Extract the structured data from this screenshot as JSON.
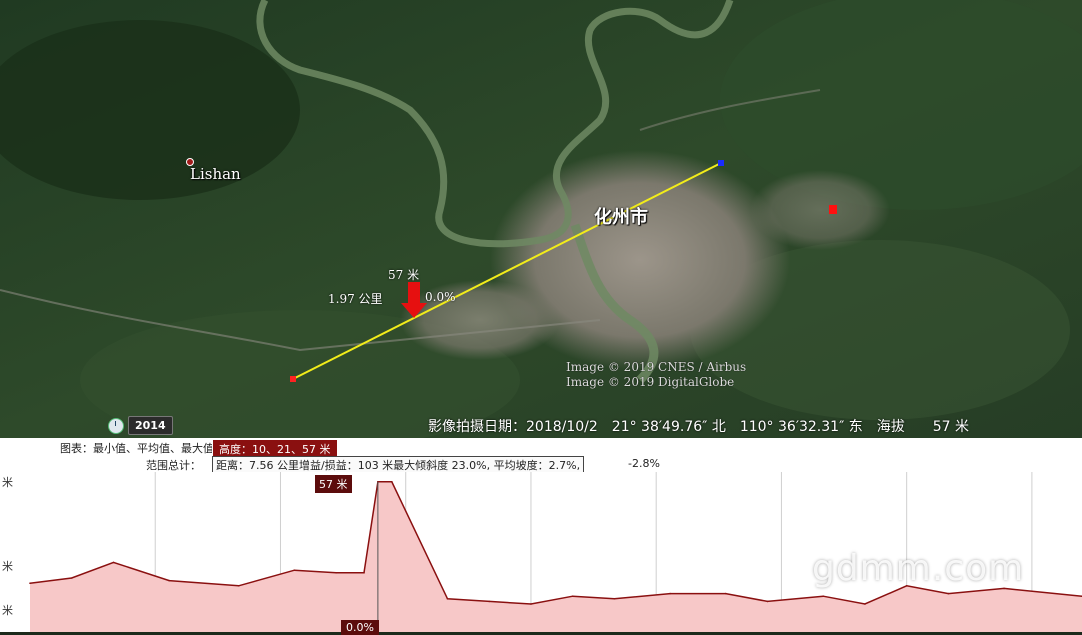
{
  "map": {
    "places": {
      "lishan": "Lishan",
      "city": "化州市"
    },
    "measure": {
      "height": "57 米",
      "distance": "1.97 公里",
      "grade": "0.0%"
    },
    "credits": [
      "Image © 2019 CNES / Airbus",
      "Image © 2019 DigitalGlobe"
    ],
    "status": {
      "imagery_date": "影像拍摄日期：2018/10/2",
      "latitude": "21° 38′49.76″ 北",
      "longitude": "110° 36′32.31″ 东",
      "elevation_label": "海拔",
      "elevation_value": "57 米"
    },
    "historical_year": "2014",
    "colors": {
      "path": "#f2ec1a",
      "start_marker": "#ff2222",
      "end_marker": "#1a2cff",
      "arrow": "#e61010"
    }
  },
  "profile": {
    "legend_label": "图表：最小值、平均值、最大值",
    "legend_value": "高度：10、21、57 米",
    "summary_label": "范围总计：",
    "summary_value": "距离：7.56 公里增益/损益：103 米最大倾斜度 23.0%, 平均坡度：2.7%,",
    "summary_extra": "-2.8%",
    "axis_unit": "米",
    "peak_label": "57 米",
    "cursor_label": "0.0%",
    "watermark": "gdmm.com",
    "colors": {
      "line": "#8a1010",
      "fill": "#f7c8c8"
    }
  },
  "chart_data": {
    "type": "area",
    "x": [
      0,
      0.3,
      0.6,
      1.0,
      1.5,
      1.9,
      2.2,
      2.4,
      2.5,
      2.6,
      3.0,
      3.3,
      3.6,
      3.9,
      4.2,
      4.6,
      5.0,
      5.3,
      5.7,
      6.0,
      6.3,
      6.6,
      7.0,
      7.56
    ],
    "values": [
      18,
      20,
      26,
      19,
      17,
      23,
      22,
      22,
      57,
      57,
      12,
      11,
      10,
      13,
      12,
      14,
      14,
      11,
      13,
      10,
      17,
      14,
      16,
      13
    ],
    "xlabel": "",
    "ylabel": "米",
    "ylim": [
      0,
      60
    ]
  }
}
